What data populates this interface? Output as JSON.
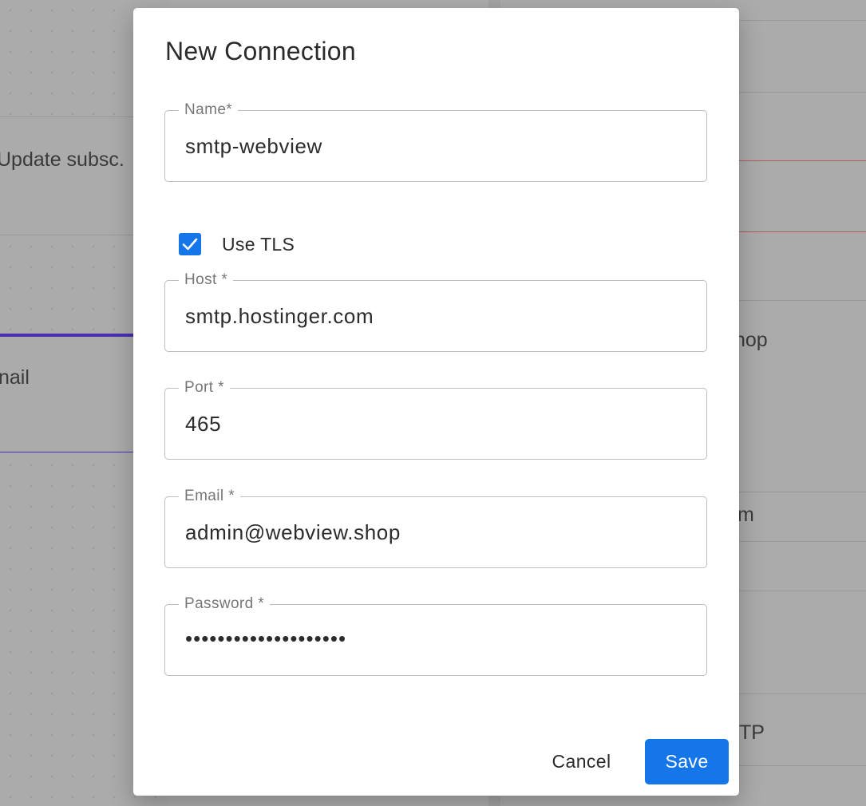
{
  "background": {
    "snippets": [
      "Update subsc.",
      "nail",
      "hop",
      "m",
      "TP"
    ]
  },
  "dialog": {
    "title": "New Connection",
    "fields": {
      "name": {
        "label": "Name*",
        "value": "smtp-webview"
      },
      "host": {
        "label": "Host *",
        "value": "smtp.hostinger.com"
      },
      "port": {
        "label": "Port *",
        "value": "465"
      },
      "email": {
        "label": "Email *",
        "value": "admin@webview.shop"
      },
      "password": {
        "label": "Password *",
        "value": "••••••••••••••••••••"
      }
    },
    "use_tls": {
      "label": "Use TLS",
      "checked": true
    },
    "buttons": {
      "cancel": "Cancel",
      "save": "Save"
    }
  },
  "colors": {
    "accent": "#1476e8",
    "overlay": "#a9a9a9"
  }
}
